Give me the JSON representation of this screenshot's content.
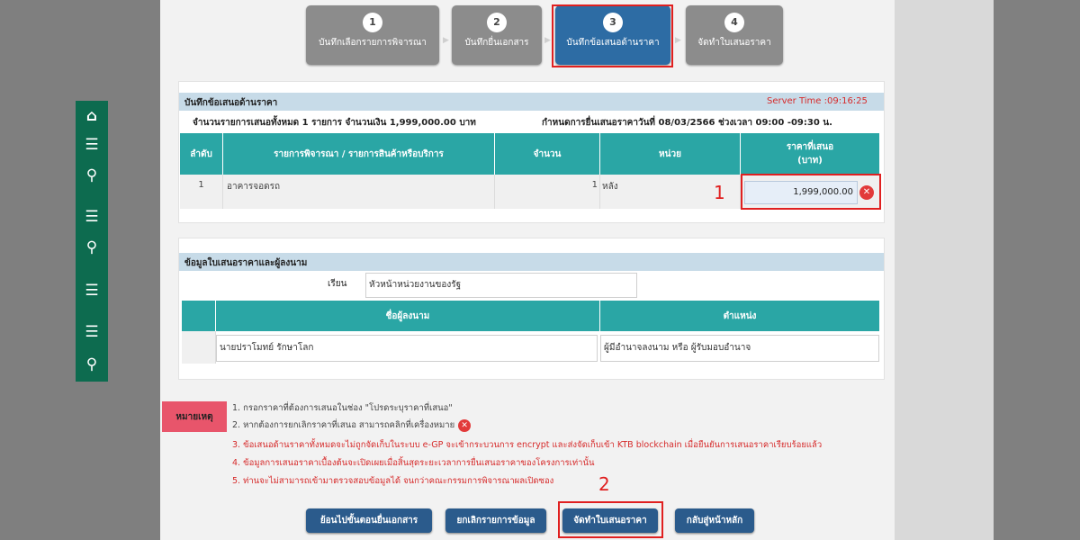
{
  "steps": [
    {
      "num": "1",
      "label": "บันทึกเลือกรายการพิจารณา"
    },
    {
      "num": "2",
      "label": "บันทึกยื่นเอกสาร"
    },
    {
      "num": "3",
      "label": "บันทึกข้อเสนอด้านราคา"
    },
    {
      "num": "4",
      "label": "จัดทำใบเสนอราคา"
    }
  ],
  "price_panel": {
    "title": "บันทึกข้อเสนอด้านราคา",
    "server_time": "Server Time :09:16:25",
    "summary": "จำนวนรายการเสนอทั้งหมด 1 รายการ จำนวนเงิน 1,999,000.00 บาท",
    "deadline": "กำหนดการยื่นเสนอราคาวันที่ 08/03/2566 ช่วงเวลา 09:00 -09:30 น.",
    "headers": [
      "ลำดับ",
      "รายการพิจารณา / รายการสินค้าหรือบริการ",
      "จำนวน",
      "หน่วย",
      "ราคาที่เสนอ",
      "(บาท)"
    ],
    "row": {
      "seq": "1",
      "item": "อาคารจอดรถ",
      "qty": "1",
      "unit": "หลัง",
      "price": "1,999,000.00"
    }
  },
  "sign_panel": {
    "title": "ข้อมูลใบเสนอราคาและผู้ลงนาม",
    "recipient_label": "เรียน",
    "recipient_value": "หัวหน้าหน่วยงานของรัฐ",
    "headers": [
      "ชื่อผู้ลงนาม",
      "ตำแหน่ง"
    ],
    "signer_name": "นายปราโมทย์ รักษาโลก",
    "signer_position": "ผู้มีอำนาจลงนาม หรือ ผู้รับมอบอำนาจ"
  },
  "notes": {
    "tag": "หมายเหตุ",
    "items": [
      "1. กรอกราคาที่ต้องการเสนอในช่อง \"โปรดระบุราคาที่เสนอ\"",
      "2. หากต้องการยกเลิกราคาที่เสนอ สามารถคลิกที่เครื่องหมาย",
      "3. ข้อเสนอด้านราคาทั้งหมดจะไม่ถูกจัดเก็บในระบบ e-GP จะเข้ากระบวนการ encrypt และส่งจัดเก็บเข้า KTB blockchain เมื่อยืนยันการเสนอราคาเรียบร้อยแล้ว",
      "4. ข้อมูลการเสนอราคาเบื้องต้นจะเปิดเผยเมื่อสิ้นสุดระยะเวลาการยื่นเสนอราคาของโครงการเท่านั้น",
      "5. ท่านจะไม่สามารถเข้ามาตรวจสอบข้อมูลได้ จนกว่าคณะกรรมการพิจารณาผลเปิดซอง"
    ]
  },
  "buttons": {
    "back_docs": "ย้อนไปขั้นตอนยื่นเอกสาร",
    "cancel": "ยกเลิกรายการข้อมูล",
    "make_quote": "จัดทำใบเสนอราคา",
    "home": "กลับสู่หน้าหลัก"
  },
  "callouts": {
    "one": "1",
    "two": "2"
  },
  "colors": {
    "accent": "#2d6ca4",
    "teal": "#2aa6a5",
    "highlight": "#e02020",
    "nav": "#0d6b4f"
  }
}
